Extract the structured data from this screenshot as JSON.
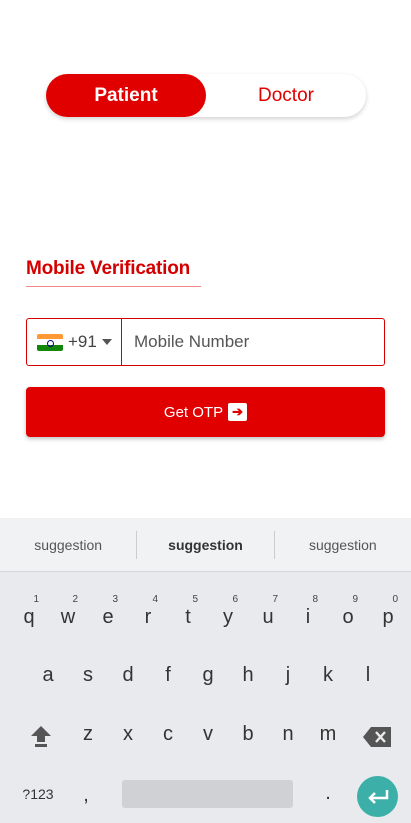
{
  "toggle": {
    "active": "Patient",
    "inactive": "Doctor"
  },
  "form": {
    "heading": "Mobile Verification",
    "country_code": "+91",
    "mobile_placeholder": "Mobile Number",
    "otp_button": "Get OTP"
  },
  "keyboard": {
    "suggestions": [
      "suggestion",
      "suggestion",
      "suggestion"
    ],
    "row1": [
      "q",
      "w",
      "e",
      "r",
      "t",
      "y",
      "u",
      "i",
      "o",
      "p"
    ],
    "row1_nums": [
      "1",
      "2",
      "3",
      "4",
      "5",
      "6",
      "7",
      "8",
      "9",
      "0"
    ],
    "row2": [
      "a",
      "s",
      "d",
      "f",
      "g",
      "h",
      "j",
      "k",
      "l"
    ],
    "row3": [
      "z",
      "x",
      "c",
      "v",
      "b",
      "n",
      "m"
    ],
    "symbols_key": "?123",
    "comma_key": ",",
    "period_key": "."
  },
  "colors": {
    "accent": "#e00000",
    "enter": "#3cb0a8"
  }
}
